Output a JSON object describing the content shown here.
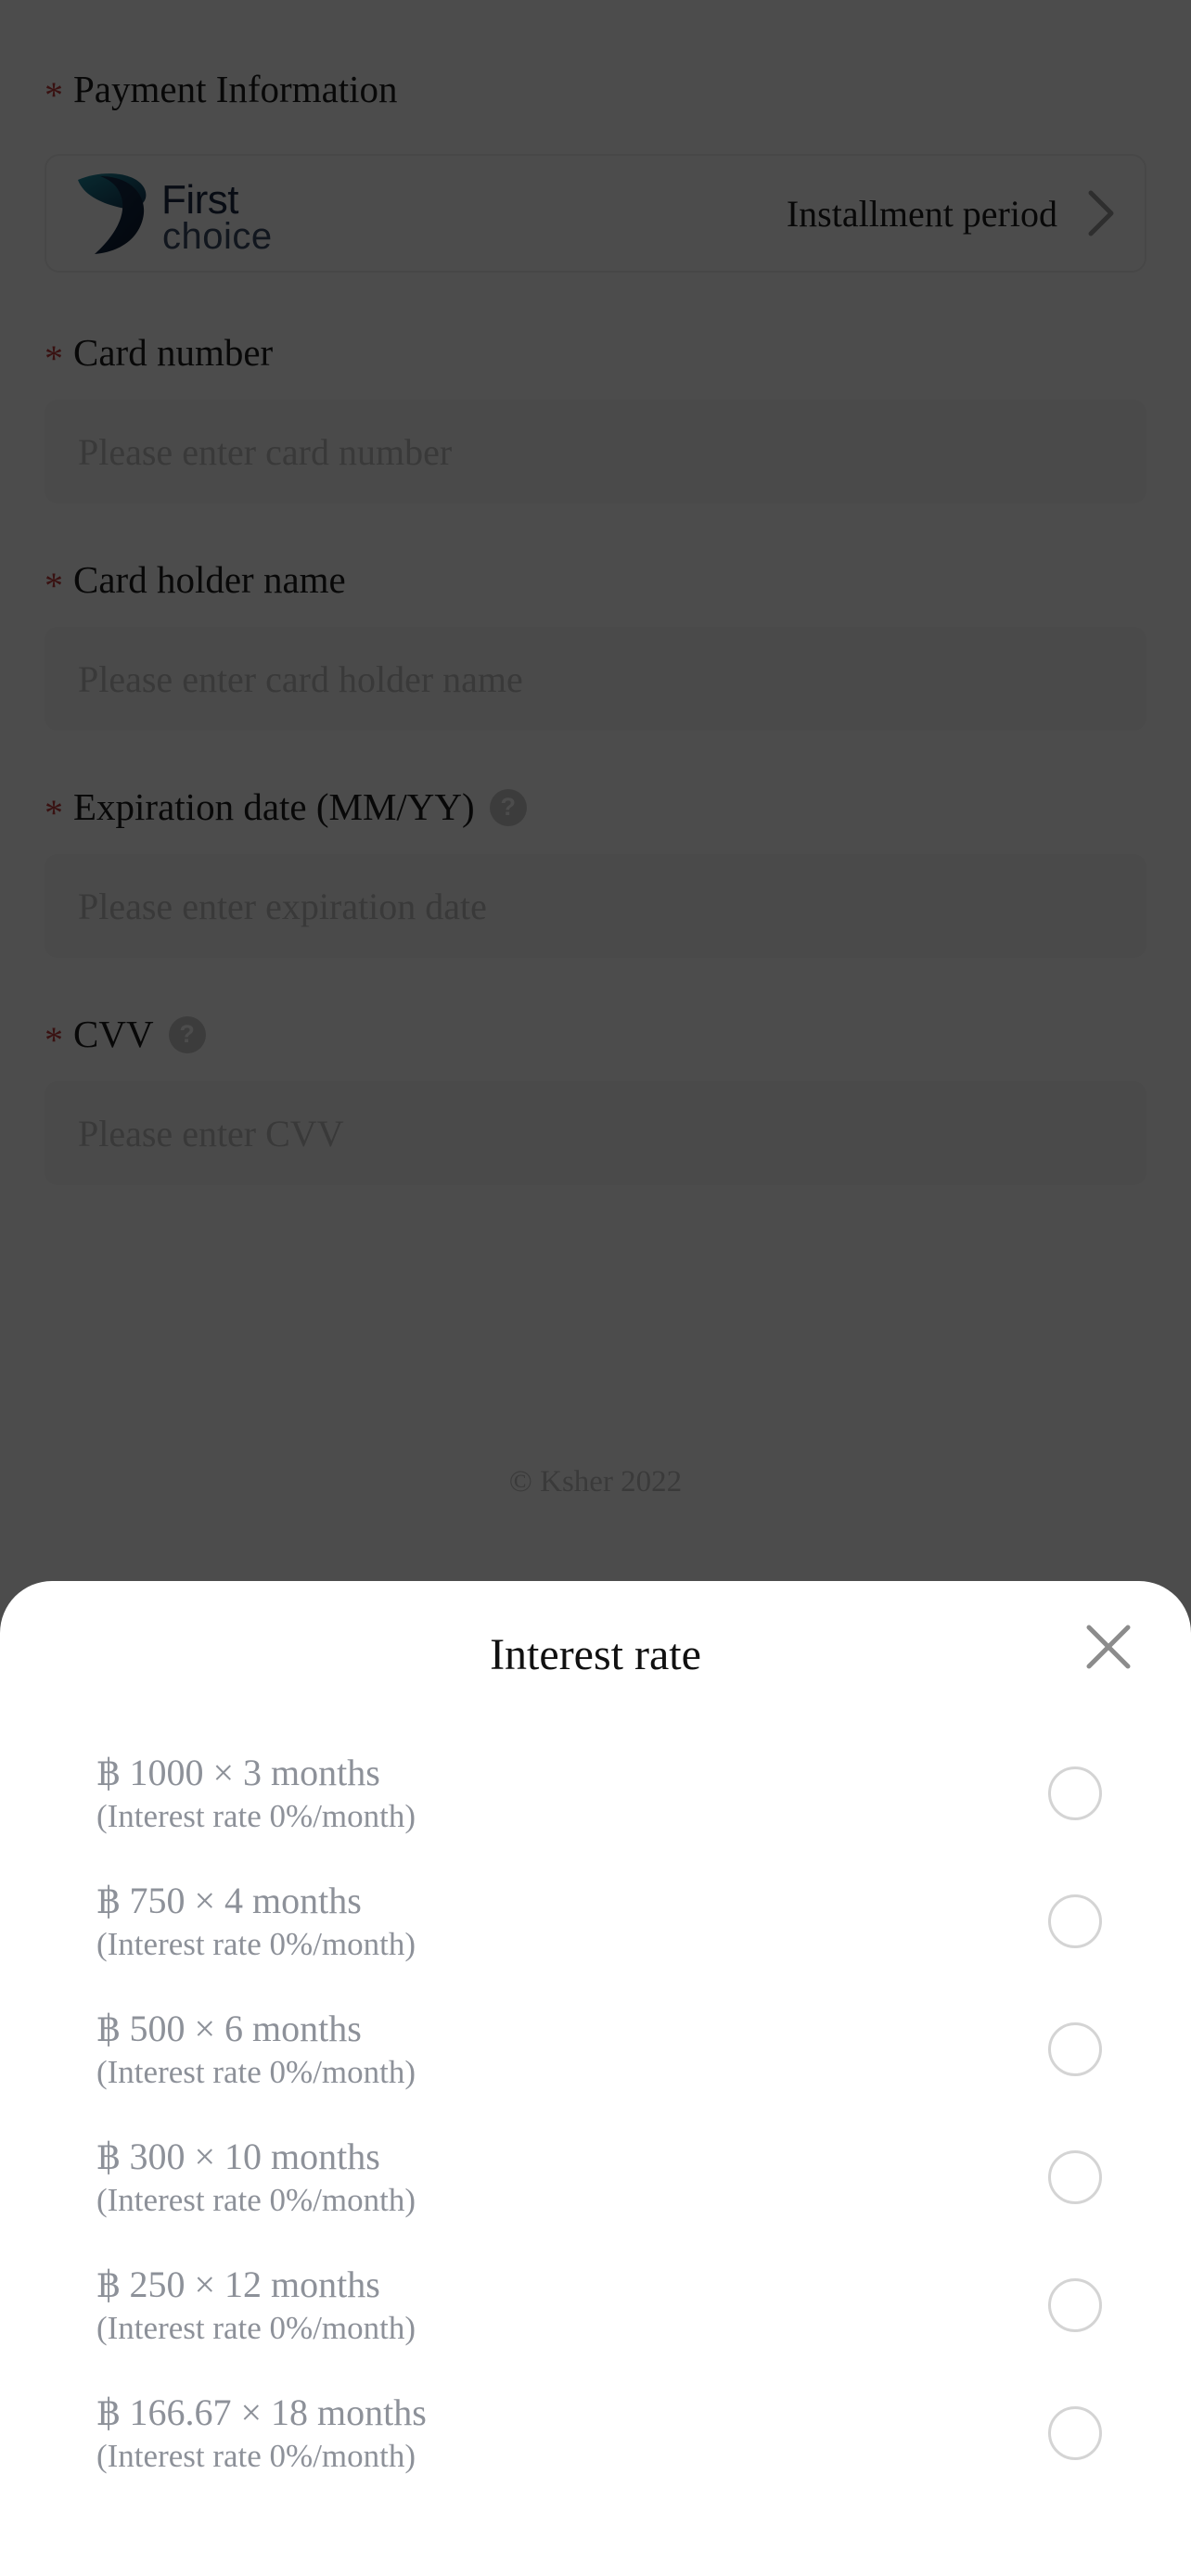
{
  "checkout": {
    "payment_information_label": "Payment Information",
    "required_marker": "*",
    "bank": {
      "name": "First choice",
      "logo_word_top": "First",
      "logo_word_bottom": "choice",
      "installment_label": "Installment period",
      "chevron_icon": "chevron-right-icon",
      "logo_colors": {
        "teal": "#1a7a8c",
        "navy": "#13294b",
        "dark_navy": "#0d1b33"
      }
    },
    "fields": [
      {
        "id": "card-number",
        "label": "Card number",
        "placeholder": "Please enter card number",
        "value": "",
        "required": true,
        "has_help": false
      },
      {
        "id": "card-holder-name",
        "label": "Card holder name",
        "placeholder": "Please enter card holder name",
        "value": "",
        "required": true,
        "has_help": false
      },
      {
        "id": "expiration-date",
        "label": "Expiration date (MM/YY)",
        "placeholder": "Please enter expiration date",
        "value": "",
        "required": true,
        "has_help": true,
        "help_icon": "question-mark-icon",
        "help_glyph": "?"
      },
      {
        "id": "cvv",
        "label": "CVV",
        "placeholder": "Please enter CVV",
        "value": "",
        "required": true,
        "has_help": true,
        "help_icon": "question-mark-icon",
        "help_glyph": "?"
      }
    ],
    "footer": "© Ksher 2022"
  },
  "modal": {
    "title": "Interest rate",
    "close_icon": "close-x-icon",
    "options": [
      {
        "amount": "฿ 1000 × 3 months",
        "rate": "(Interest rate 0%/month)",
        "selected": false
      },
      {
        "amount": "฿ 750 × 4 months",
        "rate": "(Interest rate 0%/month)",
        "selected": false
      },
      {
        "amount": "฿ 500 × 6 months",
        "rate": "(Interest rate 0%/month)",
        "selected": false
      },
      {
        "amount": "฿ 300 × 10 months",
        "rate": "(Interest rate 0%/month)",
        "selected": false
      },
      {
        "amount": "฿ 250 × 12 months",
        "rate": "(Interest rate 0%/month)",
        "selected": false
      },
      {
        "amount": "฿ 166.67 × 18 months",
        "rate": "(Interest rate 0%/month)",
        "selected": false
      }
    ]
  },
  "colors": {
    "required_star": "#c03a3a",
    "overlay": "rgba(0,0,0,0.70)",
    "input_bg": "#f7f7f7",
    "placeholder": "#bfbfbf",
    "option_text": "#8d9199"
  }
}
